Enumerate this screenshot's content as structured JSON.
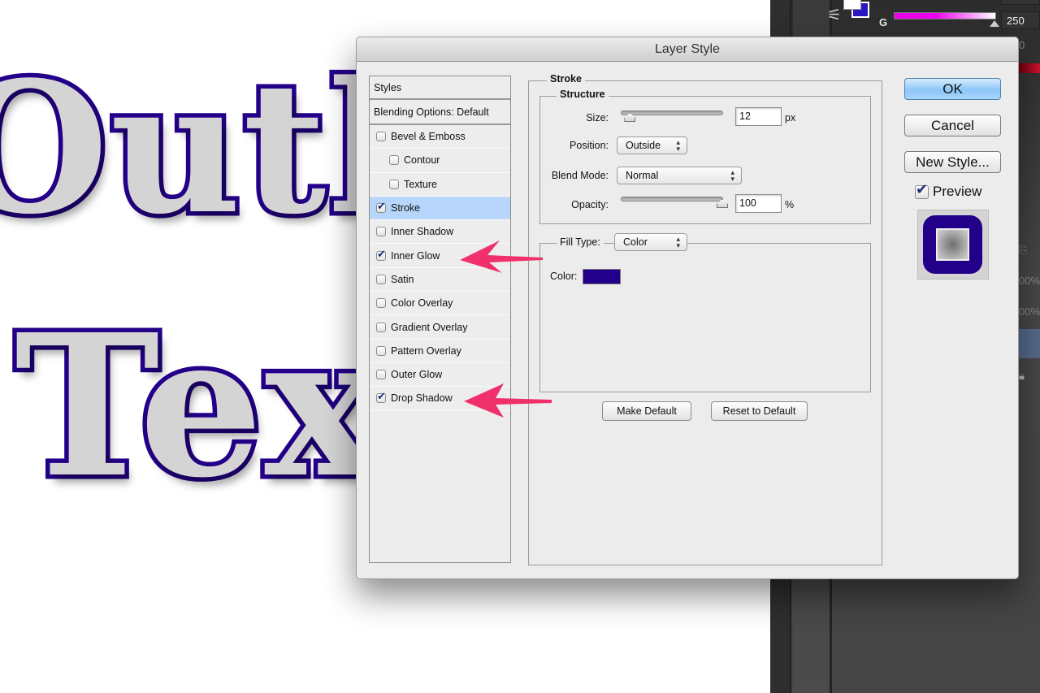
{
  "canvas": {
    "line1": "Outli",
    "line2": "Tex",
    "stroke_color": "#24008a"
  },
  "ps_panel": {
    "channel_label": "G",
    "channel_value": "250",
    "partial_values": [
      "0",
      "00%",
      "00%"
    ],
    "foreground_color": "#ffffff",
    "background_color": "#2a17c4"
  },
  "dialog": {
    "title": "Layer Style",
    "styles_list": {
      "header": "Styles",
      "blending": "Blending Options: Default",
      "items": [
        {
          "label": "Bevel & Emboss",
          "checked": false,
          "indent": false,
          "selected": false
        },
        {
          "label": "Contour",
          "checked": false,
          "indent": true,
          "selected": false
        },
        {
          "label": "Texture",
          "checked": false,
          "indent": true,
          "selected": false
        },
        {
          "label": "Stroke",
          "checked": true,
          "indent": false,
          "selected": true
        },
        {
          "label": "Inner Shadow",
          "checked": false,
          "indent": false,
          "selected": false
        },
        {
          "label": "Inner Glow",
          "checked": true,
          "indent": false,
          "selected": false
        },
        {
          "label": "Satin",
          "checked": false,
          "indent": false,
          "selected": false
        },
        {
          "label": "Color Overlay",
          "checked": false,
          "indent": false,
          "selected": false
        },
        {
          "label": "Gradient Overlay",
          "checked": false,
          "indent": false,
          "selected": false
        },
        {
          "label": "Pattern Overlay",
          "checked": false,
          "indent": false,
          "selected": false
        },
        {
          "label": "Outer Glow",
          "checked": false,
          "indent": false,
          "selected": false
        },
        {
          "label": "Drop Shadow",
          "checked": true,
          "indent": false,
          "selected": false
        }
      ]
    },
    "stroke": {
      "group_title": "Stroke",
      "structure_title": "Structure",
      "size_label": "Size:",
      "size_value": "12",
      "size_unit": "px",
      "size_slider_fraction": 0.05,
      "position_label": "Position:",
      "position_value": "Outside",
      "blend_label": "Blend Mode:",
      "blend_value": "Normal",
      "opacity_label": "Opacity:",
      "opacity_value": "100",
      "opacity_unit": "%",
      "opacity_slider_fraction": 1.0,
      "fill_type_label": "Fill Type:",
      "fill_type_value": "Color",
      "color_label": "Color:",
      "color_value": "#22008a",
      "make_default": "Make Default",
      "reset_default": "Reset to Default"
    },
    "buttons": {
      "ok": "OK",
      "cancel": "Cancel",
      "new_style": "New Style..."
    },
    "preview": {
      "label": "Preview",
      "checked": true
    }
  },
  "annotations": {
    "arrow_color": "#f0306a",
    "targets": [
      "Inner Glow",
      "Drop Shadow"
    ]
  }
}
